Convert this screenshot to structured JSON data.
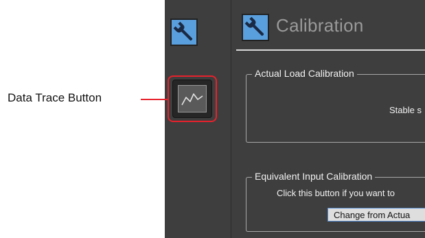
{
  "annotation": {
    "label": "Data Trace Button",
    "color": "#e8212b"
  },
  "sidebar": {
    "top_icon": "wrench-icon",
    "trace_icon": "data-trace-waveform-icon"
  },
  "header": {
    "icon": "wrench-icon",
    "title": "Calibration"
  },
  "groups": {
    "actual_load": {
      "title": "Actual Load Calibration",
      "status_text": "Stable s"
    },
    "equivalent_input": {
      "title": "Equivalent Input Calibration",
      "hint_text": "Click this button if you want to",
      "button_label": "Change from Actua"
    }
  },
  "colors": {
    "panel_bg": "#3e3e3e",
    "icon_tile": "#5a9fdd",
    "highlight": "#e8212b"
  }
}
